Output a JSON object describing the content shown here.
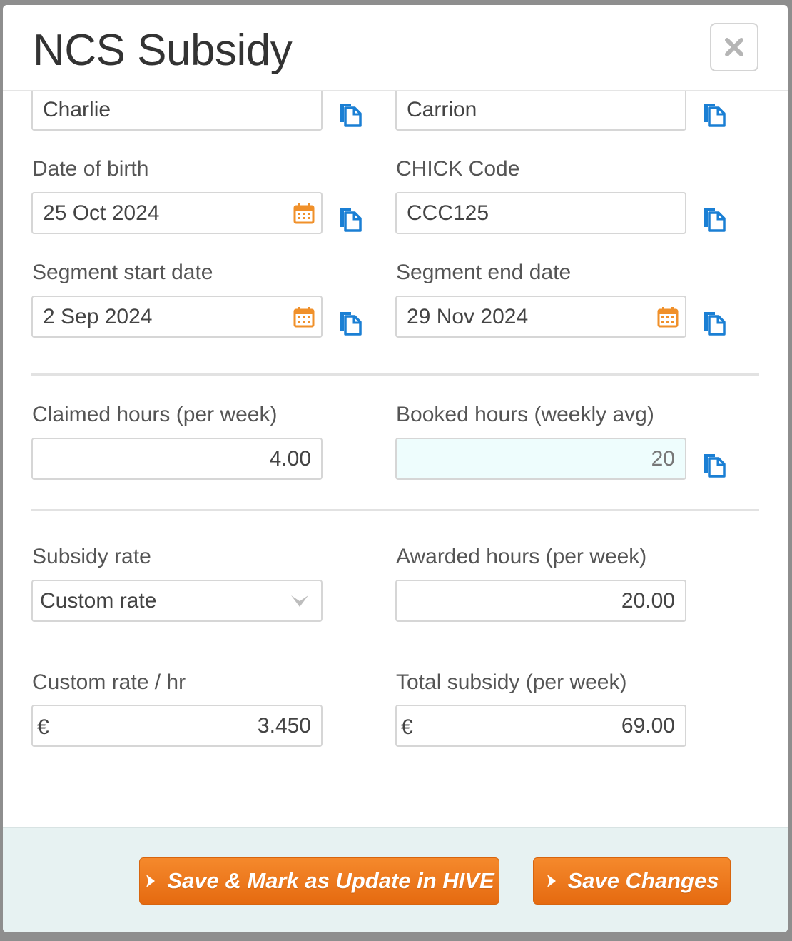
{
  "modal": {
    "title": "NCS Subsidy"
  },
  "fields": {
    "first_name": {
      "value": "Charlie"
    },
    "last_name": {
      "value": "Carrion"
    },
    "dob": {
      "label": "Date of birth",
      "value": "25 Oct 2024"
    },
    "chick_code": {
      "label": "CHICK Code",
      "value": "CCC125"
    },
    "segment_start": {
      "label": "Segment start date",
      "value": "2 Sep 2024"
    },
    "segment_end": {
      "label": "Segment end date",
      "value": "29 Nov 2024"
    },
    "claimed_hours": {
      "label": "Claimed hours (per week)",
      "value": "4.00"
    },
    "booked_hours": {
      "label": "Booked hours (weekly avg)",
      "value": "20"
    },
    "subsidy_rate": {
      "label": "Subsidy rate",
      "value": "Custom rate"
    },
    "awarded_hours": {
      "label": "Awarded hours (per week)",
      "value": "20.00"
    },
    "custom_rate": {
      "label": "Custom rate / hr",
      "prefix": "€",
      "value": "3.450"
    },
    "total_subsidy": {
      "label": "Total subsidy (per week)",
      "prefix": "€",
      "value": "69.00"
    }
  },
  "footer": {
    "save_mark_label": "Save & Mark as Update in HIVE",
    "save_label": "Save Changes"
  },
  "icons": {
    "close": "close-icon",
    "calendar": "calendar-icon",
    "copy": "copy-icon",
    "chevron": "chevron-down-icon",
    "arrow": "arrow-right-icon"
  },
  "colors": {
    "accent_orange": "#f07d1f",
    "copy_blue": "#1a7fd4",
    "calendar_orange": "#f0902a",
    "readonly_bg": "#eefdfd",
    "footer_bg": "#e7f2f2"
  }
}
